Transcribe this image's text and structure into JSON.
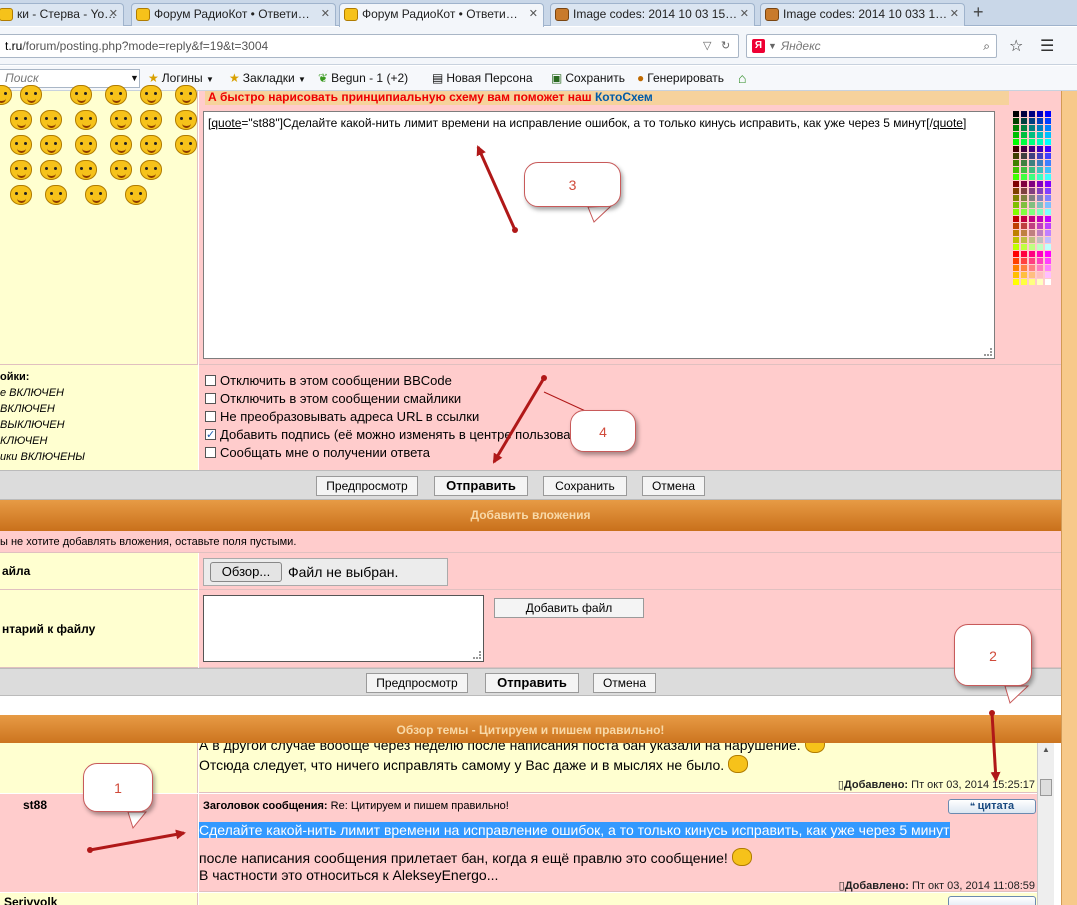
{
  "browser": {
    "tabs": [
      {
        "title": "ки - Стерва - Yo…",
        "icon": "cat-favicon-icon",
        "active": false
      },
      {
        "title": "Форум РадиоКот • Ответи…",
        "icon": "cat-favicon-icon",
        "active": false
      },
      {
        "title": "Форум РадиоКот • Ответи…",
        "icon": "cat-favicon-icon",
        "active": true
      },
      {
        "title": "Image codes: 2014 10 03 15…",
        "icon": "image-favicon-icon",
        "active": false
      },
      {
        "title": "Image codes: 2014 10 033 1…",
        "icon": "image-favicon-icon",
        "active": false
      }
    ],
    "new_tab": "+",
    "url_host": "t.ru",
    "url_path": "/forum/posting.php?mode=reply&f=19&t=3004",
    "search_placeholder": "Яндекс",
    "search_engine_letter": "Я",
    "bookmarks": {
      "search_placeholder": "Поиск",
      "items": [
        {
          "label": "Логины",
          "icon": "star-icon",
          "has_menu": true
        },
        {
          "label": "Закладки",
          "icon": "star-icon",
          "has_menu": true
        },
        {
          "label": "Begun - 1",
          "icon": "leaf-icon",
          "badge": "(+2)"
        },
        {
          "label": "Новая Персона",
          "icon": "contact-card-icon"
        },
        {
          "label": "Сохранить",
          "icon": "save-icon"
        },
        {
          "label": "Генерировать",
          "icon": "generate-icon"
        },
        {
          "label": "",
          "icon": "home-icon"
        }
      ]
    }
  },
  "posting": {
    "banner_text": "А быстро нарисовать принципиальную схему вам поможет наш ",
    "banner_link": "КотоСхем",
    "editor_text_before": "[",
    "editor_quote_open": "quote",
    "editor_text_mid": "=\"st88\"]Сделайте какой-нить лимит времени на исправление ошибок, а то только кинусь исправить, как уже через 5 минут[/",
    "editor_quote_close": "quote",
    "editor_text_after": "]",
    "settings_title": "ойки:",
    "settings": [
      {
        "text": "е ВКЛЮЧЕН"
      },
      {
        "text": "ВКЛЮЧЕН"
      },
      {
        "text": "ВЫКЛЮЧЕН"
      },
      {
        "text": "КЛЮЧЕН"
      },
      {
        "text": "ики ВКЛЮЧЕНЫ"
      }
    ],
    "options": [
      {
        "label": "Отключить в этом сообщении BBCode",
        "checked": false
      },
      {
        "label": "Отключить в этом сообщении смайлики",
        "checked": false
      },
      {
        "label": "Не преобразовывать адреса URL в ссылки",
        "checked": false
      },
      {
        "label": "Добавить подпись (её можно изменять в центре пользователя)",
        "checked": true
      },
      {
        "label": "Сообщать мне о получении ответа",
        "checked": false
      }
    ],
    "buttons": {
      "preview": "Предпросмотр",
      "submit": "Отправить",
      "save": "Сохранить",
      "cancel": "Отмена"
    }
  },
  "attachments": {
    "header": "Добавить вложения",
    "hint": "ы не хотите добавлять вложения, оставьте поля пустыми.",
    "file_label": "айла",
    "file_button": "Обзор...",
    "file_status": "Файл не выбран.",
    "comment_label": "нтарий к файлу",
    "add_file_button": "Добавить файл",
    "buttons": {
      "preview": "Предпросмотр",
      "submit": "Отправить",
      "cancel": "Отмена"
    }
  },
  "review": {
    "header": "Обзор темы - Цитируем и пишем правильно!",
    "posts": [
      {
        "author": "",
        "line1": "А в другой случае вообще через неделю после написания поста бан указали на нарушение.",
        "line2": "Отсюда следует, что ничего исправлять самому у Вас даже и в мыслях не было.",
        "added_label": "Добавлено:",
        "added_date": "Пт окт 03, 2014 15:25:17"
      },
      {
        "author": "st88",
        "subject_label": "Заголовок сообщения:",
        "subject": "Re: Цитируем и пишем правильно!",
        "quote_button": "цитата",
        "highlighted": "Сделайте какой-нить лимит времени на исправление ошибок, а то только кинусь исправить, как уже через 5 минут",
        "line2": "после написания сообщения прилетает бан, когда я ещё правлю это сообщение!",
        "line3": "В частности это относиться к AlekseyEnergo...",
        "added_label": "Добавлено:",
        "added_date": "Пт окт 03, 2014 11:08:59"
      },
      {
        "author": "Serjvvolk"
      }
    ]
  },
  "annotations": {
    "callouts": [
      "1",
      "2",
      "3",
      "4"
    ],
    "arrow_color": "#b01818"
  },
  "colors": {
    "pink_bg": "#ffcccc",
    "yellow_bg": "#ffffd0",
    "orange_bar": "#d8832e",
    "highlight": "#3399ff"
  }
}
